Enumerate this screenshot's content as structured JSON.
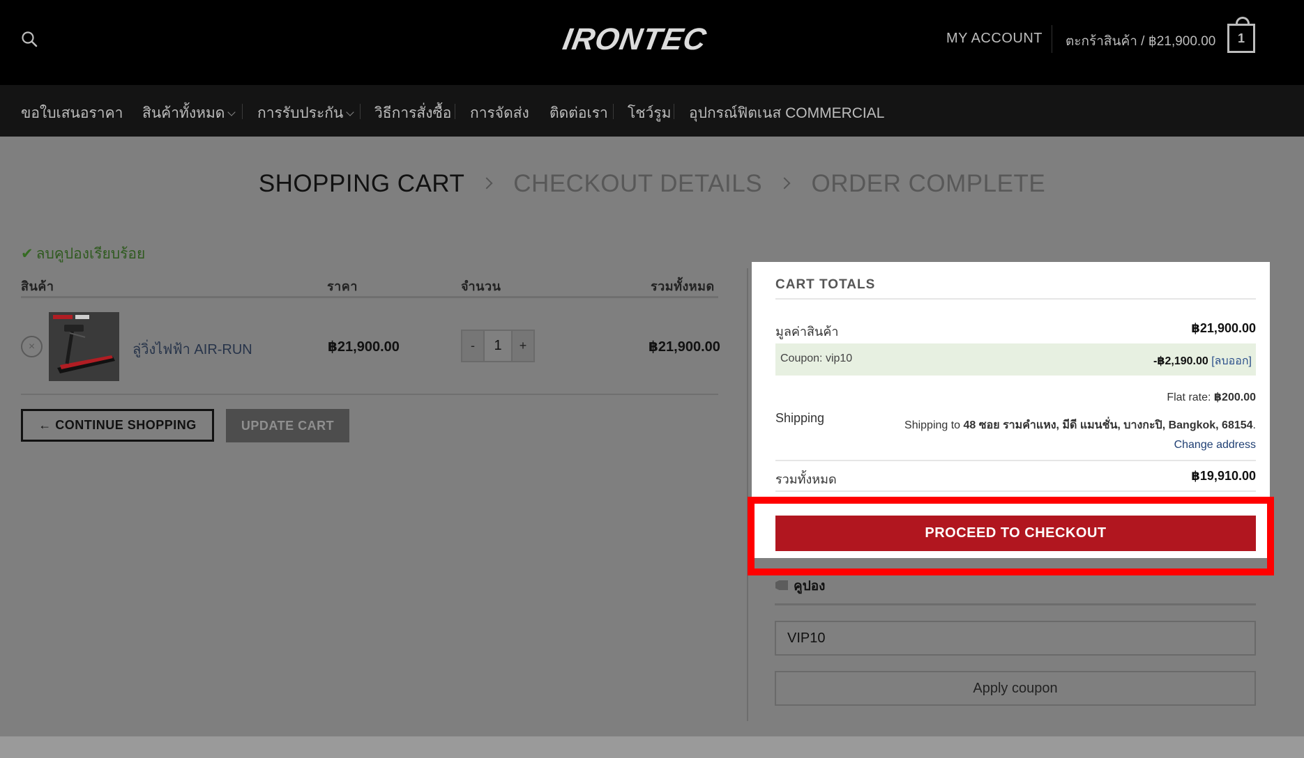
{
  "header": {
    "logo_text": "IRONTEC",
    "my_account": "MY ACCOUNT",
    "cart_link": "ตะกร้าสินค้า / ฿21,900.00",
    "cart_count": "1"
  },
  "nav": {
    "items": [
      {
        "label": "ขอใบเสนอราคา"
      },
      {
        "label": "สินค้าทั้งหมด"
      },
      {
        "label": "การรับประกัน"
      },
      {
        "label": "วิธีการสั่งซื้อ"
      },
      {
        "label": "การจัดส่ง"
      },
      {
        "label": "ติดต่อเรา"
      },
      {
        "label": "โชว์รูม"
      },
      {
        "label": "อุปกรณ์ฟิตเนส COMMERCIAL"
      }
    ]
  },
  "steps": {
    "cart": "SHOPPING CART",
    "checkout": "CHECKOUT DETAILS",
    "complete": "ORDER COMPLETE"
  },
  "notice": "ลบคูปองเรียบร้อย",
  "table": {
    "headers": {
      "product": "สินค้า",
      "price": "ราคา",
      "quantity": "จำนวน",
      "subtotal": "รวมทั้งหมด"
    },
    "rows": [
      {
        "remove": "×",
        "name": "ลู่วิ่งไฟฟ้า AIR-RUN",
        "price": "฿21,900.00",
        "qty": "1",
        "subtotal": "฿21,900.00"
      }
    ]
  },
  "qty_minus": "-",
  "qty_plus": "+",
  "buttons": {
    "continue": "← CONTINUE SHOPPING",
    "update": "UPDATE CART",
    "checkout": "PROCEED TO CHECKOUT",
    "apply_coupon": "Apply coupon"
  },
  "totals": {
    "title": "CART TOTALS",
    "subtotal_label": "มูลค่าสินค้า",
    "subtotal_value": "฿21,900.00",
    "coupon_label": "Coupon: vip10",
    "coupon_value": "-฿2,190.00",
    "coupon_remove": "[ลบออก]",
    "shipping_label": "Shipping",
    "flat_rate_label": "Flat rate:",
    "flat_rate_value": "฿200.00",
    "shipping_to_prefix": "Shipping to",
    "shipping_address": "48 ซอย รามคำแหง, มีดี แมนชั่น, บางกะปิ, Bangkok, 68154",
    "shipping_suffix": ".",
    "change_address": "Change address",
    "total_label": "รวมทั้งหมด",
    "total_value": "฿19,910.00"
  },
  "coupon": {
    "heading": "คูปอง",
    "value": "VIP10"
  }
}
